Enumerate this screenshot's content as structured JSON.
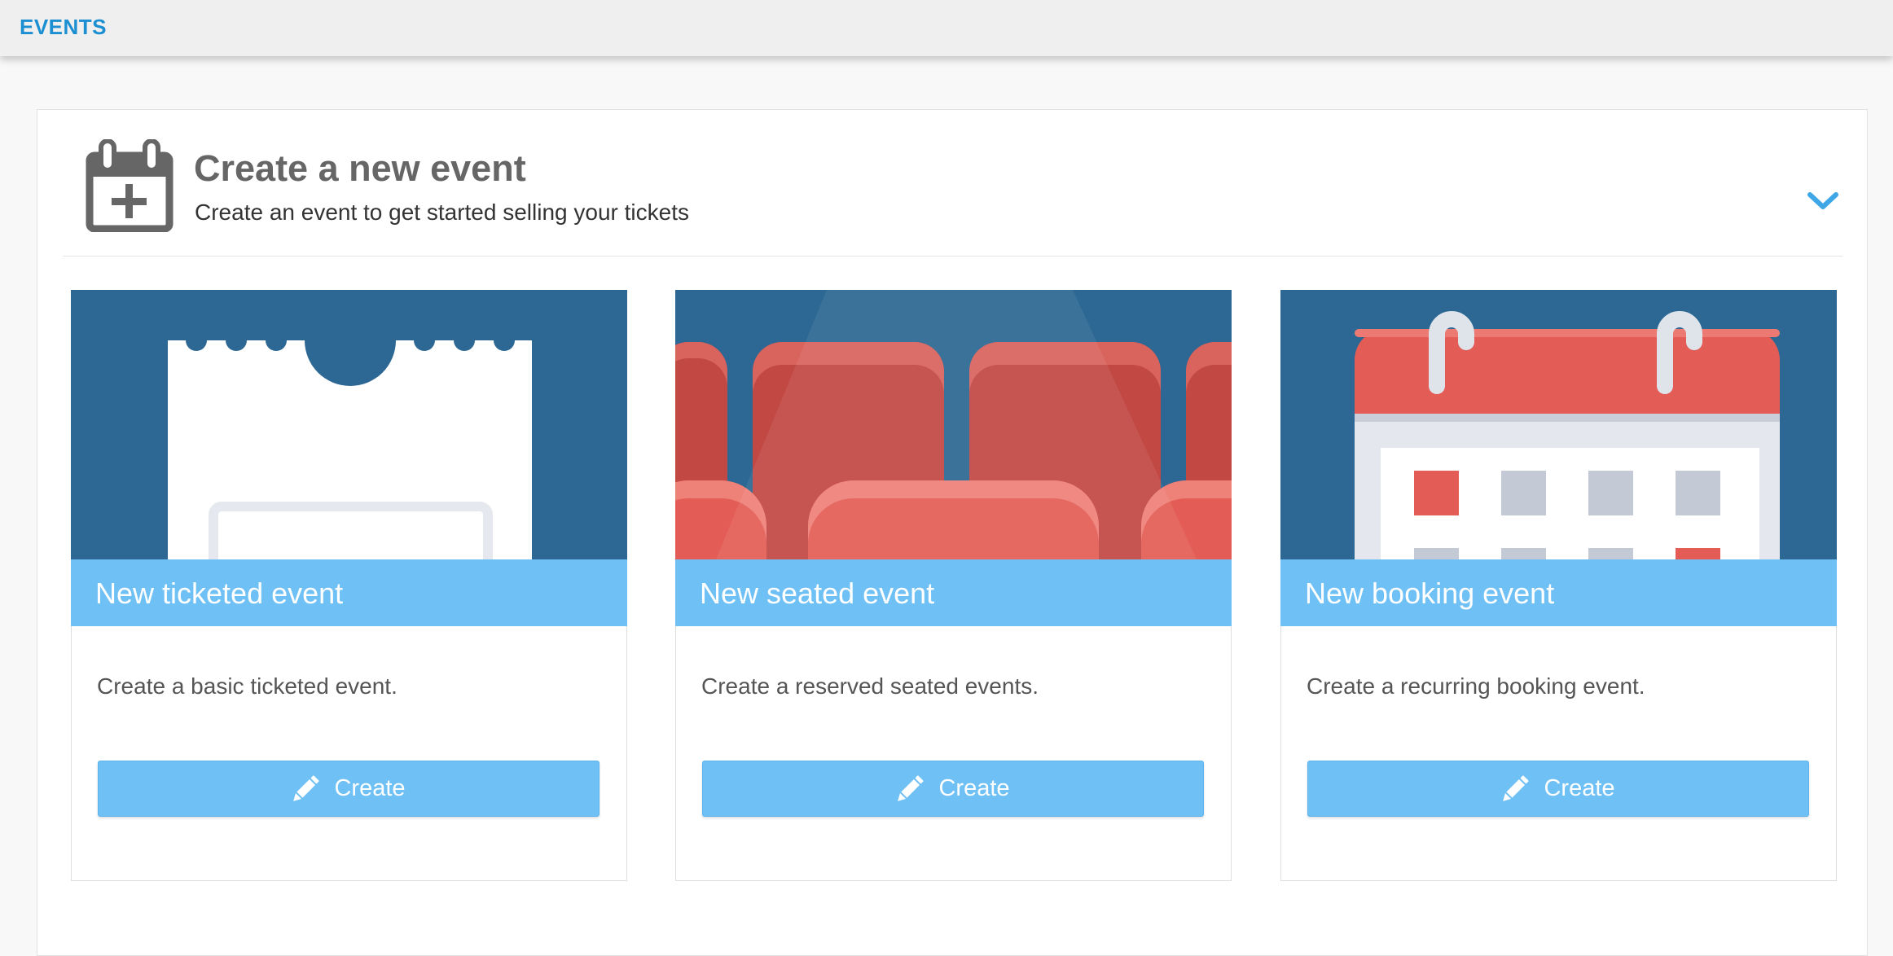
{
  "topbar": {
    "title": "EVENTS"
  },
  "header": {
    "title": "Create a new event",
    "subtitle": "Create an event to get started selling your tickets",
    "icon": "calendar-plus-icon",
    "toggle_icon": "chevron-down-icon"
  },
  "cards": [
    {
      "title": "New ticketed event",
      "description": "Create a basic ticketed event.",
      "button_label": "Create",
      "button_icon": "pencil-icon"
    },
    {
      "title": "New seated event",
      "description": "Create a reserved seated events.",
      "button_label": "Create",
      "button_icon": "pencil-icon"
    },
    {
      "title": "New booking event",
      "description": "Create a recurring booking event.",
      "button_label": "Create",
      "button_icon": "pencil-icon"
    }
  ],
  "colors": {
    "accent": "#1b8fd2",
    "band": "#6fc0f5",
    "illustration_bg": "#2c6893",
    "seat_red": "#e35d56"
  }
}
